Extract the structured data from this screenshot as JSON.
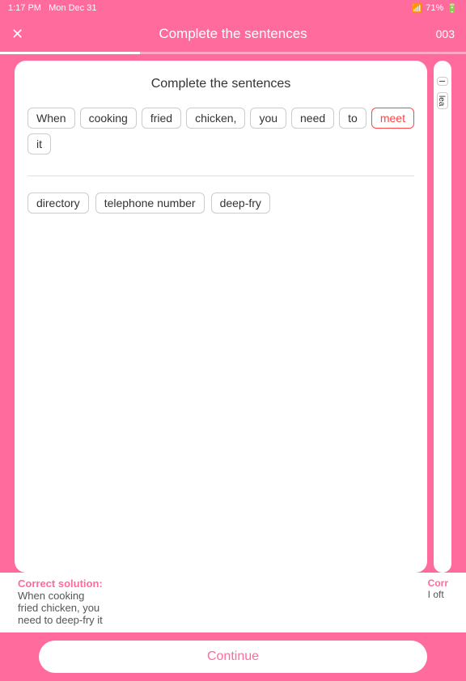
{
  "statusBar": {
    "time": "1:17 PM",
    "date": "Mon Dec 31",
    "wifi": "wifi-icon",
    "battery": "71%"
  },
  "header": {
    "title": "Complete the sentences",
    "close": "✕",
    "count": "003"
  },
  "card": {
    "title": "Complete the sentences",
    "sentenceTokens": [
      {
        "text": "When",
        "highlighted": false
      },
      {
        "text": "cooking",
        "highlighted": false
      },
      {
        "text": "fried",
        "highlighted": false
      },
      {
        "text": "chicken,",
        "highlighted": false
      },
      {
        "text": "you",
        "highlighted": false
      },
      {
        "text": "need",
        "highlighted": false
      },
      {
        "text": "to",
        "highlighted": false
      },
      {
        "text": "meet",
        "highlighted": true
      },
      {
        "text": "it",
        "highlighted": false
      }
    ],
    "wordBankTokens": [
      {
        "text": "directory"
      },
      {
        "text": "telephone number"
      },
      {
        "text": "deep-fry"
      }
    ]
  },
  "sideCard": {
    "tokens": [
      "I",
      "lea"
    ]
  },
  "solution": {
    "label": "Correct solution:",
    "text": "When cooking fried chicken, you need to deep-fry it"
  },
  "continueButton": {
    "label": "Continue"
  }
}
